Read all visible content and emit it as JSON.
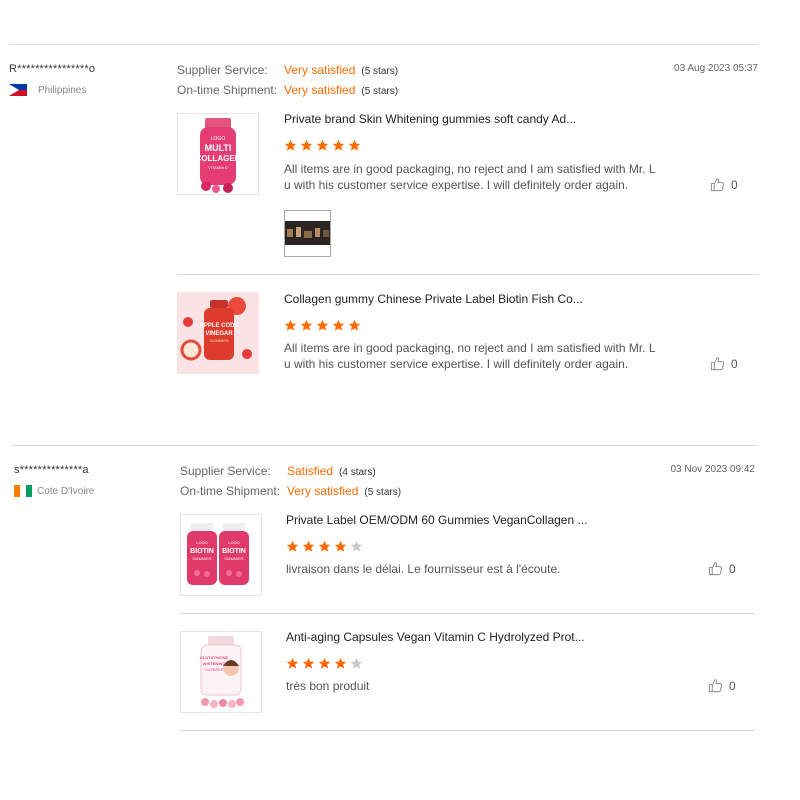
{
  "reviews": [
    {
      "user": "R****************o",
      "country": "Philippines",
      "ratings": [
        {
          "label": "Supplier Service:",
          "value": "Very satisfied",
          "stars_text": "(5 stars)"
        },
        {
          "label": "On-time Shipment:",
          "value": "Very satisfied",
          "stars_text": "(5 stars)"
        }
      ],
      "date": "03 Aug 2023 05:37",
      "products": [
        {
          "title": "Private brand Skin Whitening gummies soft candy Ad...",
          "stars": 5,
          "comment": "All items are in good packaging, no reject and I am satisfied with Mr. Lu with his customer service expertise. I will definitely order again.",
          "likes": "0",
          "label_lines": [
            "LOGO",
            "MULTI",
            "COLLAGEN",
            "VITAMIN E"
          ]
        },
        {
          "title": "Collagen gummy Chinese Private Label Biotin Fish Co...",
          "stars": 5,
          "comment": "All items are in good packaging, no reject and I am satisfied with Mr. Lu with his customer service expertise. I will definitely order again.",
          "likes": "0",
          "label_lines": [
            "APPLE CODE",
            "VINEGAR",
            "GUMMIES"
          ]
        }
      ]
    },
    {
      "user": "s**************a",
      "country": "Cote D'Ivoire",
      "ratings": [
        {
          "label": "Supplier Service:",
          "value": "Satisfied",
          "stars_text": "(4 stars)"
        },
        {
          "label": "On-time Shipment:",
          "value": "Very satisfied",
          "stars_text": "(5 stars)"
        }
      ],
      "date": "03 Nov 2023 09:42",
      "products": [
        {
          "title": "Private Label OEM/ODM 60 Gummies VeganCollagen ...",
          "stars": 4,
          "comment": "livraison dans le délai. Le fournisseur est à l'écoute.",
          "likes": "0",
          "label_lines": [
            "LOGO",
            "BIOTIN",
            "GUMMIES"
          ]
        },
        {
          "title": "Anti-aging Capsules Vegan Vitamin C Hydrolyzed Prot...",
          "stars": 4,
          "comment": "très bon produit",
          "likes": "0",
          "label_lines": [
            "GLUTATHIONE",
            "WHITENING",
            "GUMMIES"
          ]
        }
      ]
    }
  ],
  "colors": {
    "accent": "#ff6a00",
    "star_empty": "#c8c8c8",
    "rule": "#dcdcdc"
  },
  "icons": {
    "like": "thumbs-up-icon",
    "star": "star-icon"
  }
}
